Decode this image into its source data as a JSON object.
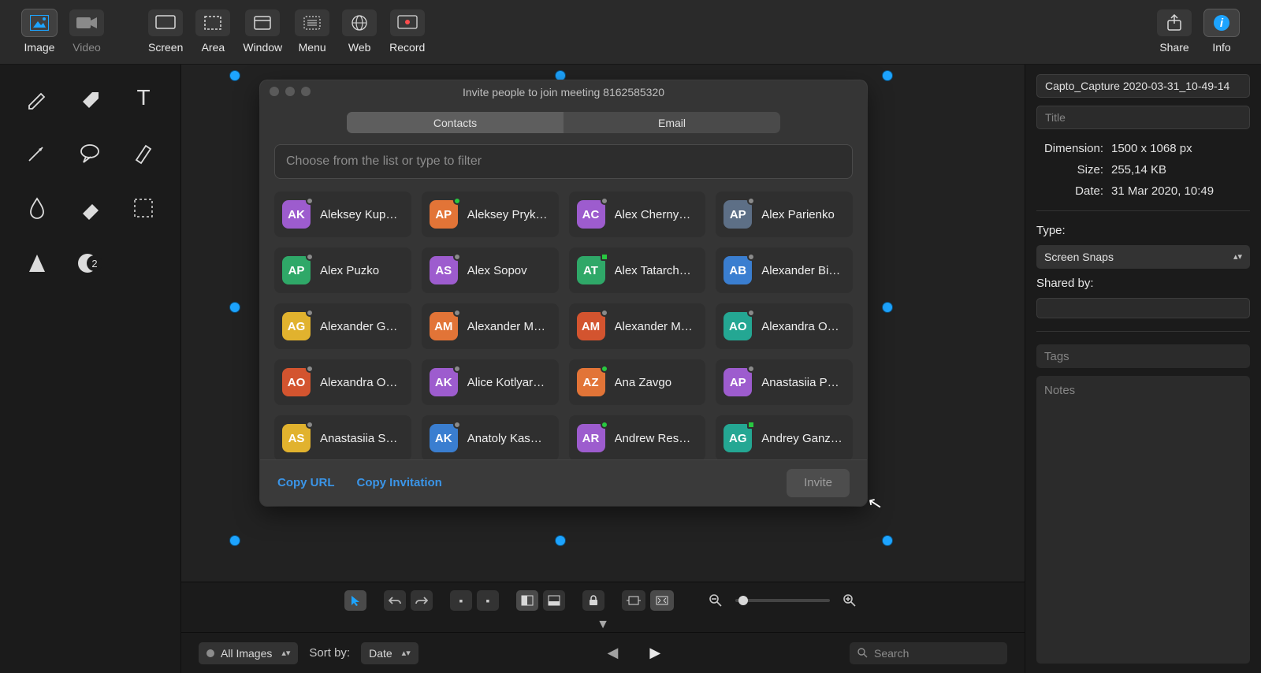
{
  "topbar": {
    "image": "Image",
    "video": "Video",
    "screen": "Screen",
    "area": "Area",
    "window": "Window",
    "menu": "Menu",
    "web": "Web",
    "record": "Record",
    "share": "Share",
    "info": "Info"
  },
  "modal": {
    "title": "Invite people to join meeting 8162585320",
    "tab_contacts": "Contacts",
    "tab_email": "Email",
    "search_placeholder": "Choose from the list or type to filter",
    "copy_url": "Copy URL",
    "copy_invitation": "Copy Invitation",
    "invite_btn": "Invite",
    "contacts": [
      {
        "ini": "AK",
        "name": "Aleksey Kup…",
        "color": "#9d5cce",
        "status": "off"
      },
      {
        "ini": "AP",
        "name": "Aleksey Pryk…",
        "color": "#e27437",
        "status": "on"
      },
      {
        "ini": "AC",
        "name": "Alex Cherny…",
        "color": "#9d5cce",
        "status": "off"
      },
      {
        "ini": "AP",
        "name": "Alex Parienko",
        "color": "#5d6f86",
        "status": "off"
      },
      {
        "ini": "AP",
        "name": "Alex Puzko",
        "color": "#2fa868",
        "status": "off"
      },
      {
        "ini": "AS",
        "name": "Alex Sopov",
        "color": "#9d5cce",
        "status": "off"
      },
      {
        "ini": "AT",
        "name": "Alex Tatarch…",
        "color": "#2fa868",
        "status": "sq"
      },
      {
        "ini": "AB",
        "name": "Alexander Bi…",
        "color": "#3a7ed0",
        "status": "off"
      },
      {
        "ini": "AG",
        "name": "Alexander G…",
        "color": "#e1b22e",
        "status": "off"
      },
      {
        "ini": "AM",
        "name": "Alexander M…",
        "color": "#e27437",
        "status": "off"
      },
      {
        "ini": "AM",
        "name": "Alexander M…",
        "color": "#d3542f",
        "status": "off"
      },
      {
        "ini": "AO",
        "name": "Alexandra O…",
        "color": "#24a793",
        "status": "off"
      },
      {
        "ini": "AO",
        "name": "Alexandra O…",
        "color": "#d3542f",
        "status": "off"
      },
      {
        "ini": "AK",
        "name": "Alice Kotlyar…",
        "color": "#9d5cce",
        "status": "off"
      },
      {
        "ini": "AZ",
        "name": "Ana Zavgo",
        "color": "#e27437",
        "status": "on"
      },
      {
        "ini": "AP",
        "name": "Anastasiia P…",
        "color": "#9d5cce",
        "status": "off"
      },
      {
        "ini": "AS",
        "name": "Anastasiia S…",
        "color": "#e1b22e",
        "status": "off"
      },
      {
        "ini": "AK",
        "name": "Anatoly Kas…",
        "color": "#3a7ed0",
        "status": "off"
      },
      {
        "ini": "AR",
        "name": "Andrew Res…",
        "color": "#9d5cce",
        "status": "on"
      },
      {
        "ini": "AG",
        "name": "Andrey Ganz…",
        "color": "#24a793",
        "status": "sq"
      }
    ]
  },
  "right": {
    "filename": "Capto_Capture 2020-03-31_10-49-14",
    "title_ph": "Title",
    "dim_k": "Dimension:",
    "dim_v": "1500 x 1068 px",
    "size_k": "Size:",
    "size_v": "255,14 KB",
    "date_k": "Date:",
    "date_v": "31 Mar 2020, 10:49",
    "type_lbl": "Type:",
    "type_val": "Screen Snaps",
    "shared_lbl": "Shared by:",
    "tags_ph": "Tags",
    "notes_ph": "Notes"
  },
  "gallery": {
    "filter": "All Images",
    "sort_lbl": "Sort by:",
    "sort_val": "Date",
    "search_ph": "Search"
  }
}
